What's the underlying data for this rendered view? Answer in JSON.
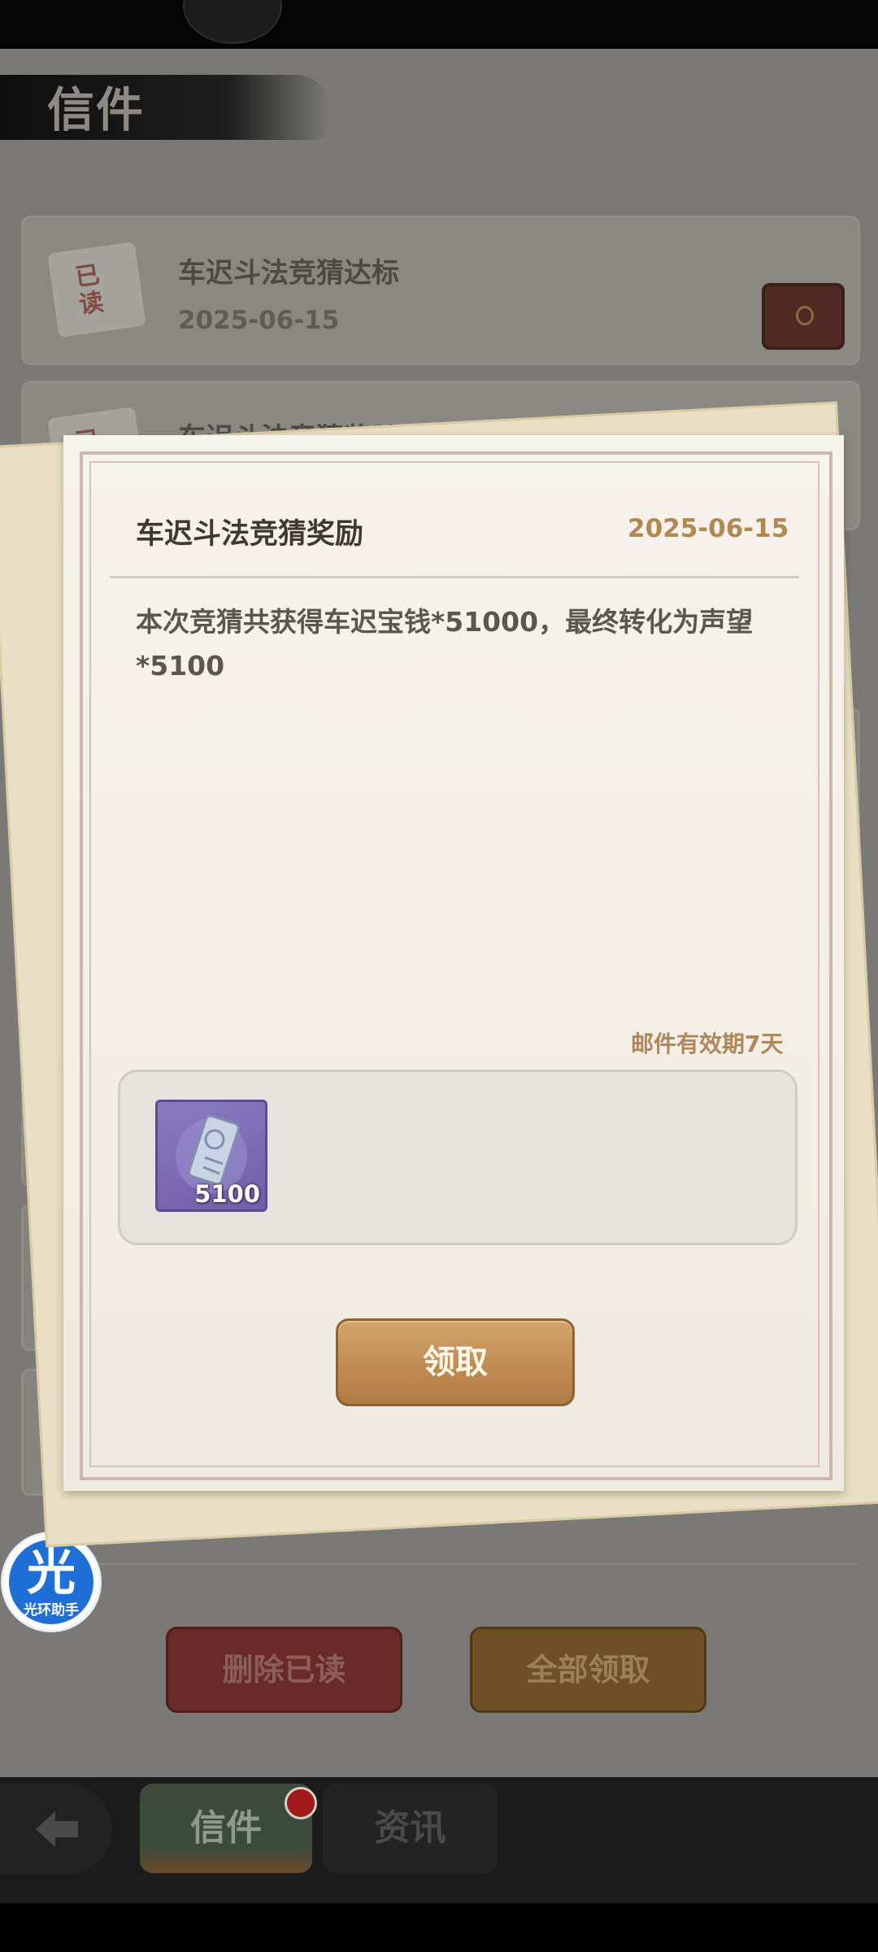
{
  "page": {
    "title": "信件"
  },
  "mail_list": [
    {
      "title": "车迟斗法竞猜达标",
      "date": "2025-06-15",
      "read_stamp": "已读"
    },
    {
      "title": "车迟斗法竞猜奖励",
      "read_stamp": "已"
    }
  ],
  "letter": {
    "title": "车迟斗法竞猜奖励",
    "date": "2025-06-15",
    "body": "本次竞猜共获得车迟宝钱*51000，最终转化为声望\n*5100",
    "expiry": "邮件有效期7天",
    "reward": {
      "icon": "reputation-token-icon",
      "quantity": "5100"
    },
    "claim_label": "领取"
  },
  "actions": {
    "delete_read_label": "删除已读",
    "claim_all_label": "全部领取"
  },
  "helper": {
    "glyph": "光",
    "label": "光环助手"
  },
  "bottom_nav": {
    "tabs": [
      {
        "label": "信件",
        "active": true,
        "badge": true
      },
      {
        "label": "资讯",
        "active": false
      }
    ]
  },
  "colors": {
    "accent_gold": "#c08c52",
    "date_gold": "#b08852",
    "badge_red": "#a11a1a",
    "helper_blue": "#1f6fd6"
  }
}
